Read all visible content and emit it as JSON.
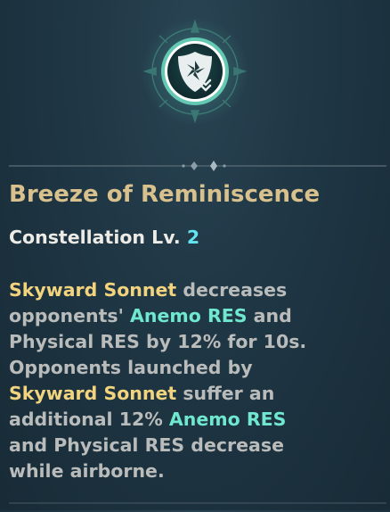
{
  "emblem": {
    "icon": "anemo-shield-icon"
  },
  "constellation": {
    "name": "Breeze of Reminiscence",
    "level_label": "Constellation Lv.",
    "level_value": "2"
  },
  "description": {
    "lines": [
      [
        {
          "t": "Skyward Sonnet",
          "c": "gold"
        },
        {
          "t": " decreases",
          "c": "plain"
        }
      ],
      [
        {
          "t": "opponents' ",
          "c": "plain"
        },
        {
          "t": "Anemo RES",
          "c": "anemo"
        },
        {
          "t": " and",
          "c": "plain"
        }
      ],
      [
        {
          "t": "Physical RES by 12% for 10s.",
          "c": "plain"
        }
      ],
      [
        {
          "t": "Opponents launched by",
          "c": "plain"
        }
      ],
      [
        {
          "t": "Skyward Sonnet",
          "c": "gold"
        },
        {
          "t": " suffer an",
          "c": "plain"
        }
      ],
      [
        {
          "t": "additional 12% ",
          "c": "plain"
        },
        {
          "t": "Anemo RES",
          "c": "anemo"
        }
      ],
      [
        {
          "t": "and Physical RES decrease",
          "c": "plain"
        }
      ],
      [
        {
          "t": "while airborne.",
          "c": "plain"
        }
      ]
    ]
  },
  "colors": {
    "title": "#d9c18e",
    "level_number": "#63e5f0",
    "highlight_gold": "#f2d37e",
    "highlight_anemo": "#6fe8cf",
    "body_text": "#b9bcba",
    "background": "#1f3644"
  }
}
